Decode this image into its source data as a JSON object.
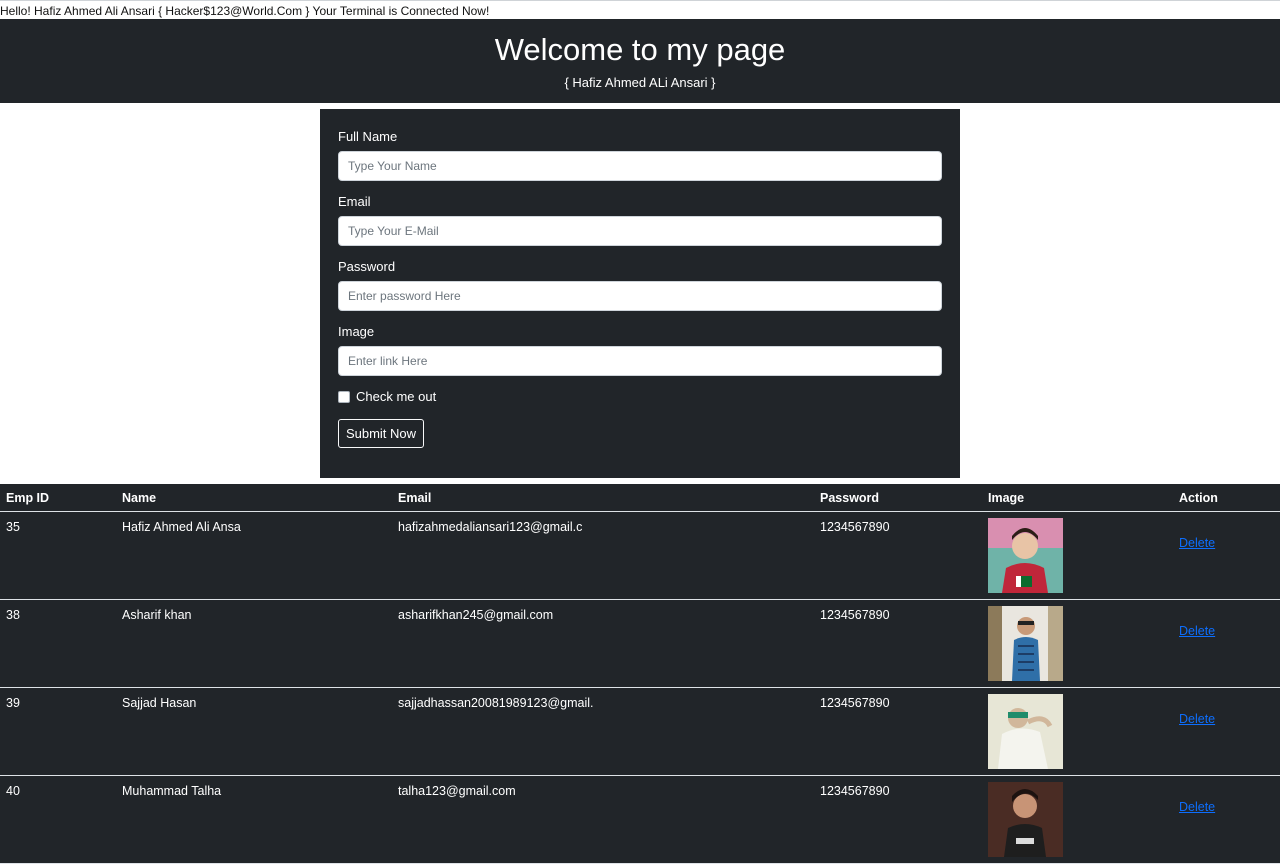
{
  "banner": {
    "text": "Hello! Hafiz Ahmed Ali Ansari { Hacker$123@World.Com } Your Terminal is Connected Now!"
  },
  "header": {
    "title": "Welcome to my page",
    "subtitle": "{ Hafiz Ahmed ALi Ansari }"
  },
  "form": {
    "name_label": "Full Name",
    "name_placeholder": "Type Your Name",
    "email_label": "Email",
    "email_placeholder": "Type Your E-Mail",
    "password_label": "Password",
    "password_placeholder": "Enter password Here",
    "image_label": "Image",
    "image_placeholder": "Enter link Here",
    "check_label": "Check me out",
    "submit_label": "Submit Now"
  },
  "table": {
    "headers": [
      "Emp ID",
      "Name",
      "Email",
      "Password",
      "Image",
      "Action"
    ],
    "rows": [
      {
        "id": "35",
        "name": "Hafiz Ahmed Ali Ansa",
        "email": "hafizahmedaliansari123@gmail.c",
        "password": "1234567890",
        "action": "Delete"
      },
      {
        "id": "38",
        "name": "Asharif khan",
        "email": "asharifkhan245@gmail.com",
        "password": "1234567890",
        "action": "Delete"
      },
      {
        "id": "39",
        "name": "Sajjad Hasan",
        "email": "sajjadhassan20081989123@gmail.",
        "password": "1234567890",
        "action": "Delete"
      },
      {
        "id": "40",
        "name": "Muhammad Talha",
        "email": "talha123@gmail.com",
        "password": "1234567890",
        "action": "Delete"
      }
    ]
  },
  "colors": {
    "dark": "#212529",
    "link": "#0d6efd"
  }
}
